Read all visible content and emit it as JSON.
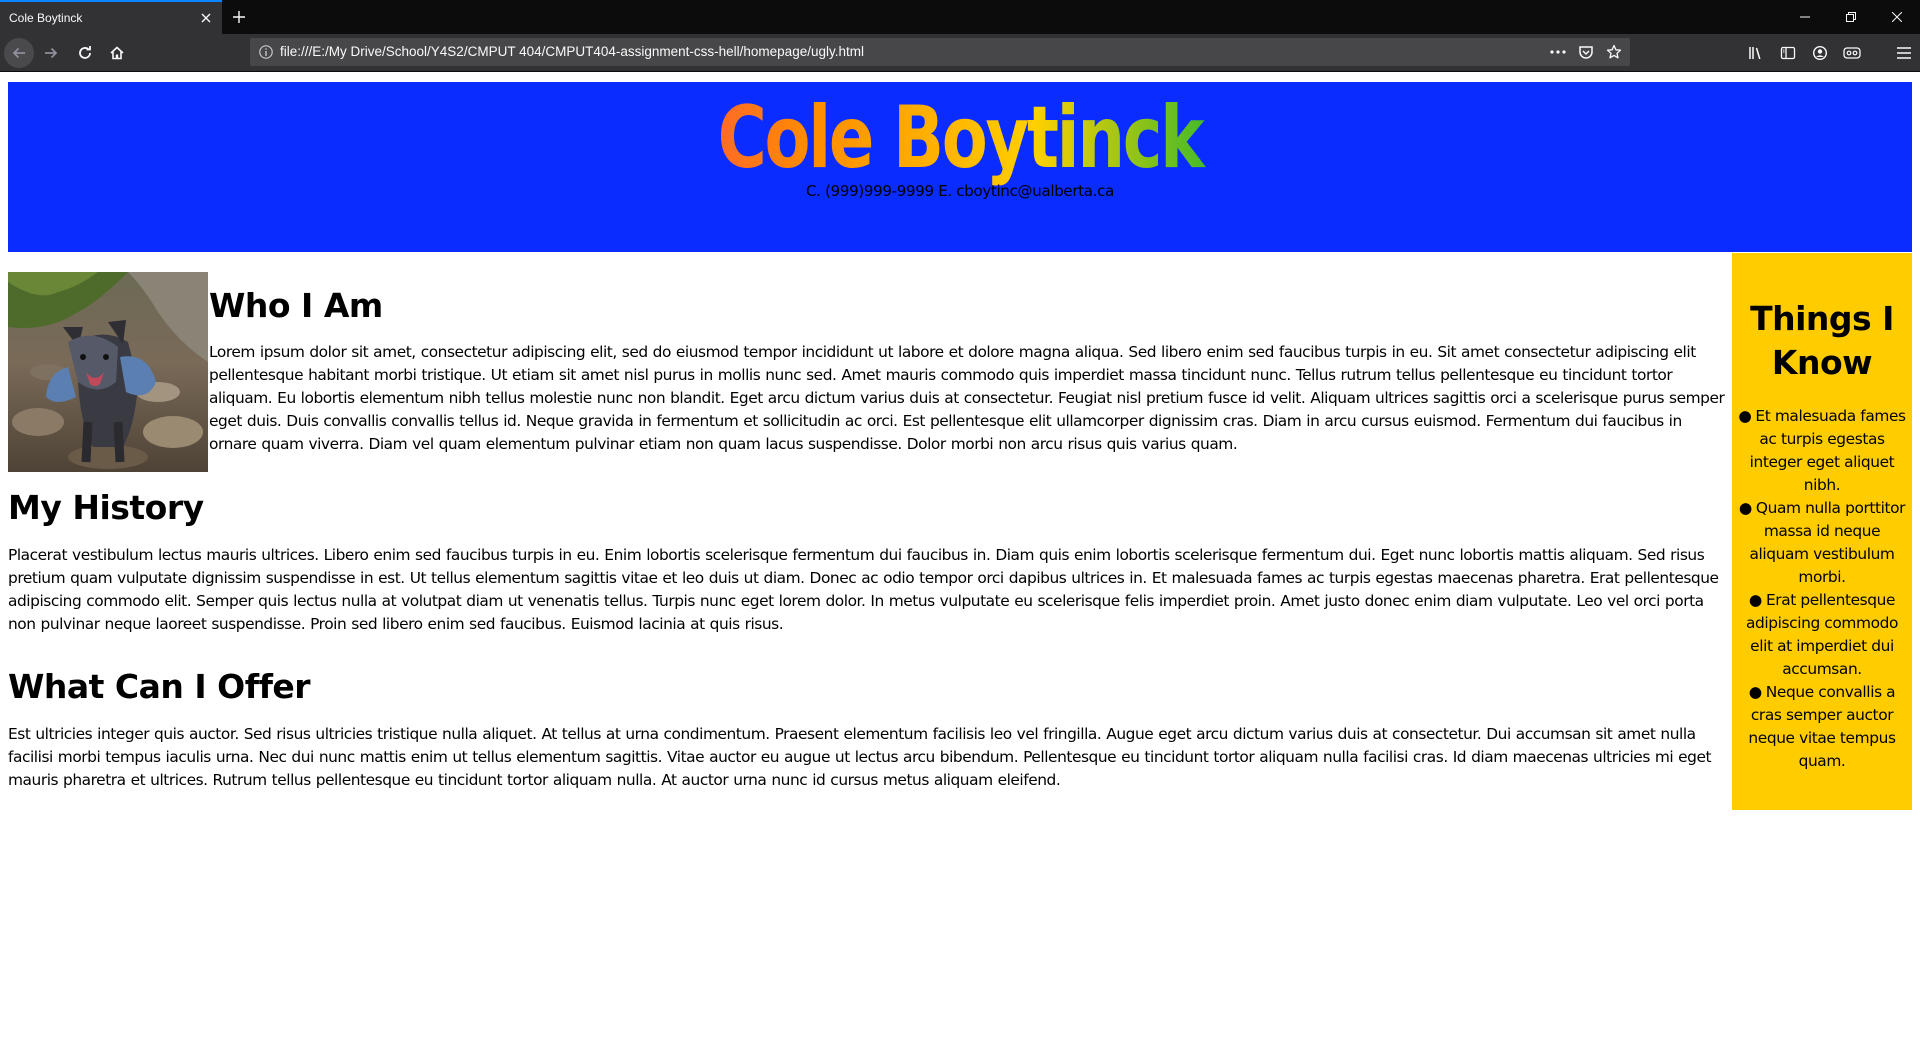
{
  "browser": {
    "tab_title": "Cole Boytinck",
    "url": "file:///E:/My Drive/School/Y4S2/CMPUT 404/CMPUT404-assignment-css-hell/homepage/ugly.html",
    "icons": {
      "back": "back-arrow-icon",
      "forward": "forward-arrow-icon",
      "reload": "reload-icon",
      "home": "home-icon",
      "info": "info-icon",
      "page_actions": "more-horizontal-icon",
      "pocket": "pocket-icon",
      "bookmark": "star-icon",
      "library": "library-icon",
      "sidebar": "sidebar-icon",
      "account": "account-icon",
      "extension": "extension-icon",
      "menu": "hamburger-menu-icon"
    },
    "accent_color": "#0a84ff"
  },
  "page": {
    "header": {
      "title": "Cole Boytinck",
      "contact": "C. (999)999-9999 E. cboytinc@ualberta.ca",
      "background": "#0a2cff"
    },
    "sections": {
      "who": {
        "heading": "Who I Am",
        "body": "Lorem ipsum dolor sit amet, consectetur adipiscing elit, sed do eiusmod tempor incididunt ut labore et dolore magna aliqua. Sed libero enim sed faucibus turpis in eu. Sit amet consectetur adipiscing elit pellentesque habitant morbi tristique. Ut etiam sit amet nisl purus in mollis nunc sed. Amet mauris commodo quis imperdiet massa tincidunt nunc. Tellus rutrum tellus pellentesque eu tincidunt tortor aliquam. Eu lobortis elementum nibh tellus molestie nunc non blandit. Eget arcu dictum varius duis at consectetur. Feugiat nisl pretium fusce id velit. Aliquam ultrices sagittis orci a scelerisque purus semper eget duis. Duis convallis convallis tellus id. Neque gravida in fermentum et sollicitudin ac orci. Est pellentesque elit ullamcorper dignissim cras. Diam in arcu cursus euismod. Fermentum dui faucibus in ornare quam viverra. Diam vel quam elementum pulvinar etiam non quam lacus suspendisse. Dolor morbi non arcu risus quis varius quam."
      },
      "history": {
        "heading": "My History",
        "body": "Placerat vestibulum lectus mauris ultrices. Libero enim sed faucibus turpis in eu. Enim lobortis scelerisque fermentum dui faucibus in. Diam quis enim lobortis scelerisque fermentum dui. Eget nunc lobortis mattis aliquam. Sed risus pretium quam vulputate dignissim suspendisse in est. Ut tellus elementum sagittis vitae et leo duis ut diam. Donec ac odio tempor orci dapibus ultrices in. Et malesuada fames ac turpis egestas maecenas pharetra. Erat pellentesque adipiscing commodo elit. Semper quis lectus nulla at volutpat diam ut venenatis tellus. Turpis nunc eget lorem dolor. In metus vulputate eu scelerisque felis imperdiet proin. Amet justo donec enim diam vulputate. Leo vel orci porta non pulvinar neque laoreet suspendisse. Proin sed libero enim sed faucibus. Euismod lacinia at quis risus."
      },
      "offer": {
        "heading": "What Can I Offer",
        "body": "Est ultricies integer quis auctor. Sed risus ultricies tristique nulla aliquet. At tellus at urna condimentum. Praesent elementum facilisis leo vel fringilla. Augue eget arcu dictum varius duis at consectetur. Dui accumsan sit amet nulla facilisi morbi tempus iaculis urna. Nec dui nunc mattis enim ut tellus elementum sagittis. Vitae auctor eu augue ut lectus arcu bibendum. Pellentesque eu tincidunt tortor aliquam nulla facilisi cras. Id diam maecenas ultricies mi eget mauris pharetra et ultrices. Rutrum tellus pellentesque eu tincidunt tortor aliquam nulla. At auctor urna nunc id cursus metus aliquam eleifend."
      }
    },
    "aside": {
      "title": "Things I Know",
      "background": "#ffcc00",
      "items": [
        "Et malesuada fames ac turpis egestas integer eget aliquet nibh.",
        "Quam nulla porttitor massa id neque aliquam vestibulum morbi.",
        "Erat pellentesque adipiscing commodo elit at imperdiet dui accumsan.",
        "Neque convallis a cras semper auctor neque vitae tempus quam."
      ]
    }
  }
}
